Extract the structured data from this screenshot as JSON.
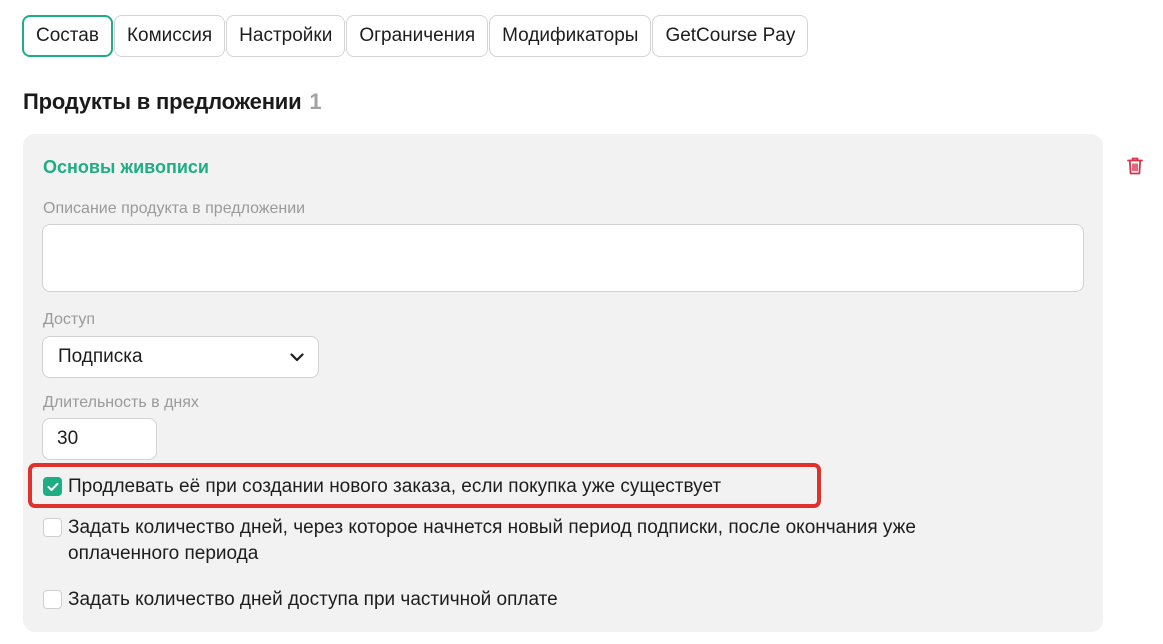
{
  "tabs": [
    {
      "label": "Состав",
      "active": true
    },
    {
      "label": "Комиссия",
      "active": false
    },
    {
      "label": "Настройки",
      "active": false
    },
    {
      "label": "Ограничения",
      "active": false
    },
    {
      "label": "Модификаторы",
      "active": false
    },
    {
      "label": "GetCourse Pay",
      "active": false
    }
  ],
  "section": {
    "title": "Продукты в предложении",
    "count": "1"
  },
  "product": {
    "name": "Основы живописи",
    "description_label": "Описание продукта в предложении",
    "description_value": "",
    "access_label": "Доступ",
    "access_value": "Подписка",
    "duration_label": "Длительность в днях",
    "duration_value": "30",
    "options": [
      {
        "label": "Продлевать её при создании нового заказа, если покупка уже существует",
        "checked": true
      },
      {
        "label": "Задать количество дней, через которое начнется новый период подписки, после окончания уже",
        "label_line2": "оплаченного периода",
        "checked": false
      },
      {
        "label": "Задать количество дней доступа при частичной оплате",
        "checked": false
      }
    ]
  },
  "icons": {
    "delete": "trash-icon",
    "dropdown": "chevron-down-icon",
    "check": "checkmark-icon"
  },
  "colors": {
    "accent": "#1fae84",
    "highlight": "#e0322c",
    "delete": "#d9344a",
    "muted": "#9a9a9a"
  }
}
